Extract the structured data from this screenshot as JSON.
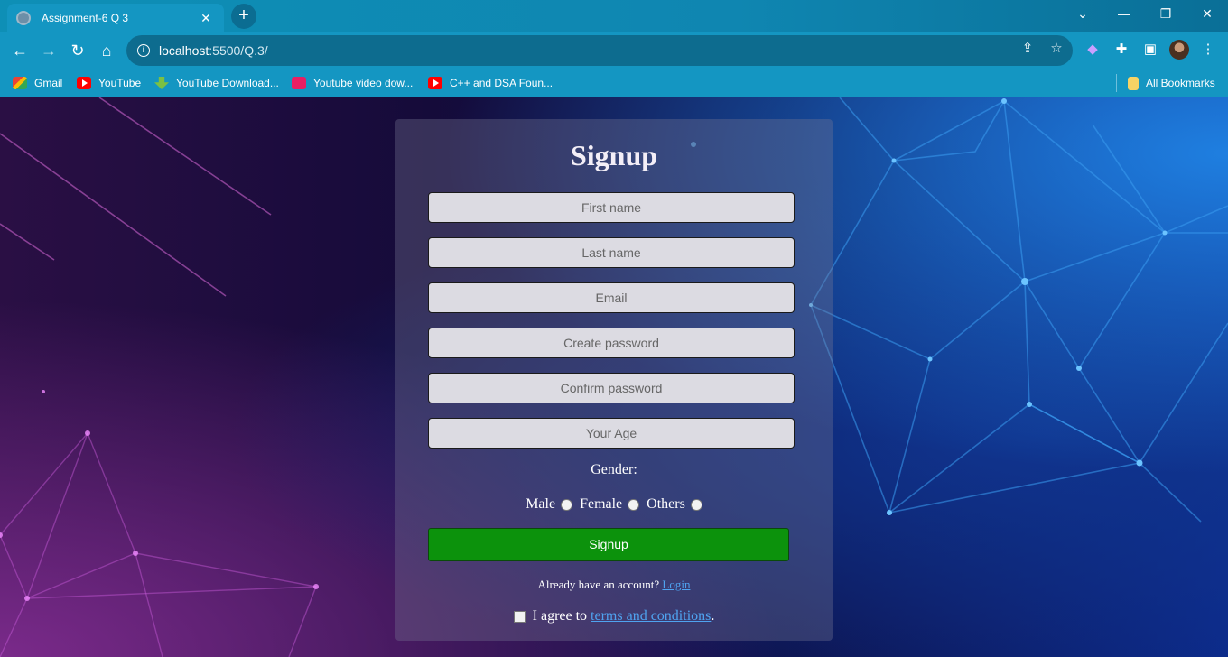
{
  "browser": {
    "tab_title": "Assignment-6 Q 3",
    "url_host": "localhost",
    "url_path": ":5500/Q.3/",
    "bookmarks": [
      {
        "label": "Gmail",
        "icon": "gmail-icon"
      },
      {
        "label": "YouTube",
        "icon": "youtube-icon"
      },
      {
        "label": "YouTube Download...",
        "icon": "download-icon"
      },
      {
        "label": "Youtube video dow...",
        "icon": "u-icon"
      },
      {
        "label": "C++ and DSA Foun...",
        "icon": "youtube-icon"
      }
    ],
    "all_bookmarks": "All Bookmarks"
  },
  "form": {
    "title": "Signup",
    "fields": [
      {
        "placeholder": "First name"
      },
      {
        "placeholder": "Last name"
      },
      {
        "placeholder": "Email"
      },
      {
        "placeholder": "Create password"
      },
      {
        "placeholder": "Confirm password"
      },
      {
        "placeholder": "Your Age"
      }
    ],
    "gender_label": "Gender:",
    "gender_options": [
      "Male",
      "Female",
      "Others"
    ],
    "submit_label": "Signup",
    "already_text": "Already have an account?",
    "login_link": "Login",
    "agree_prefix": "I agree to",
    "terms_link": "terms and conditions",
    "agree_suffix": "."
  },
  "colors": {
    "signup_button": "#0c920c",
    "link": "#4fa3f0",
    "browser_chrome": "#1496c2"
  }
}
